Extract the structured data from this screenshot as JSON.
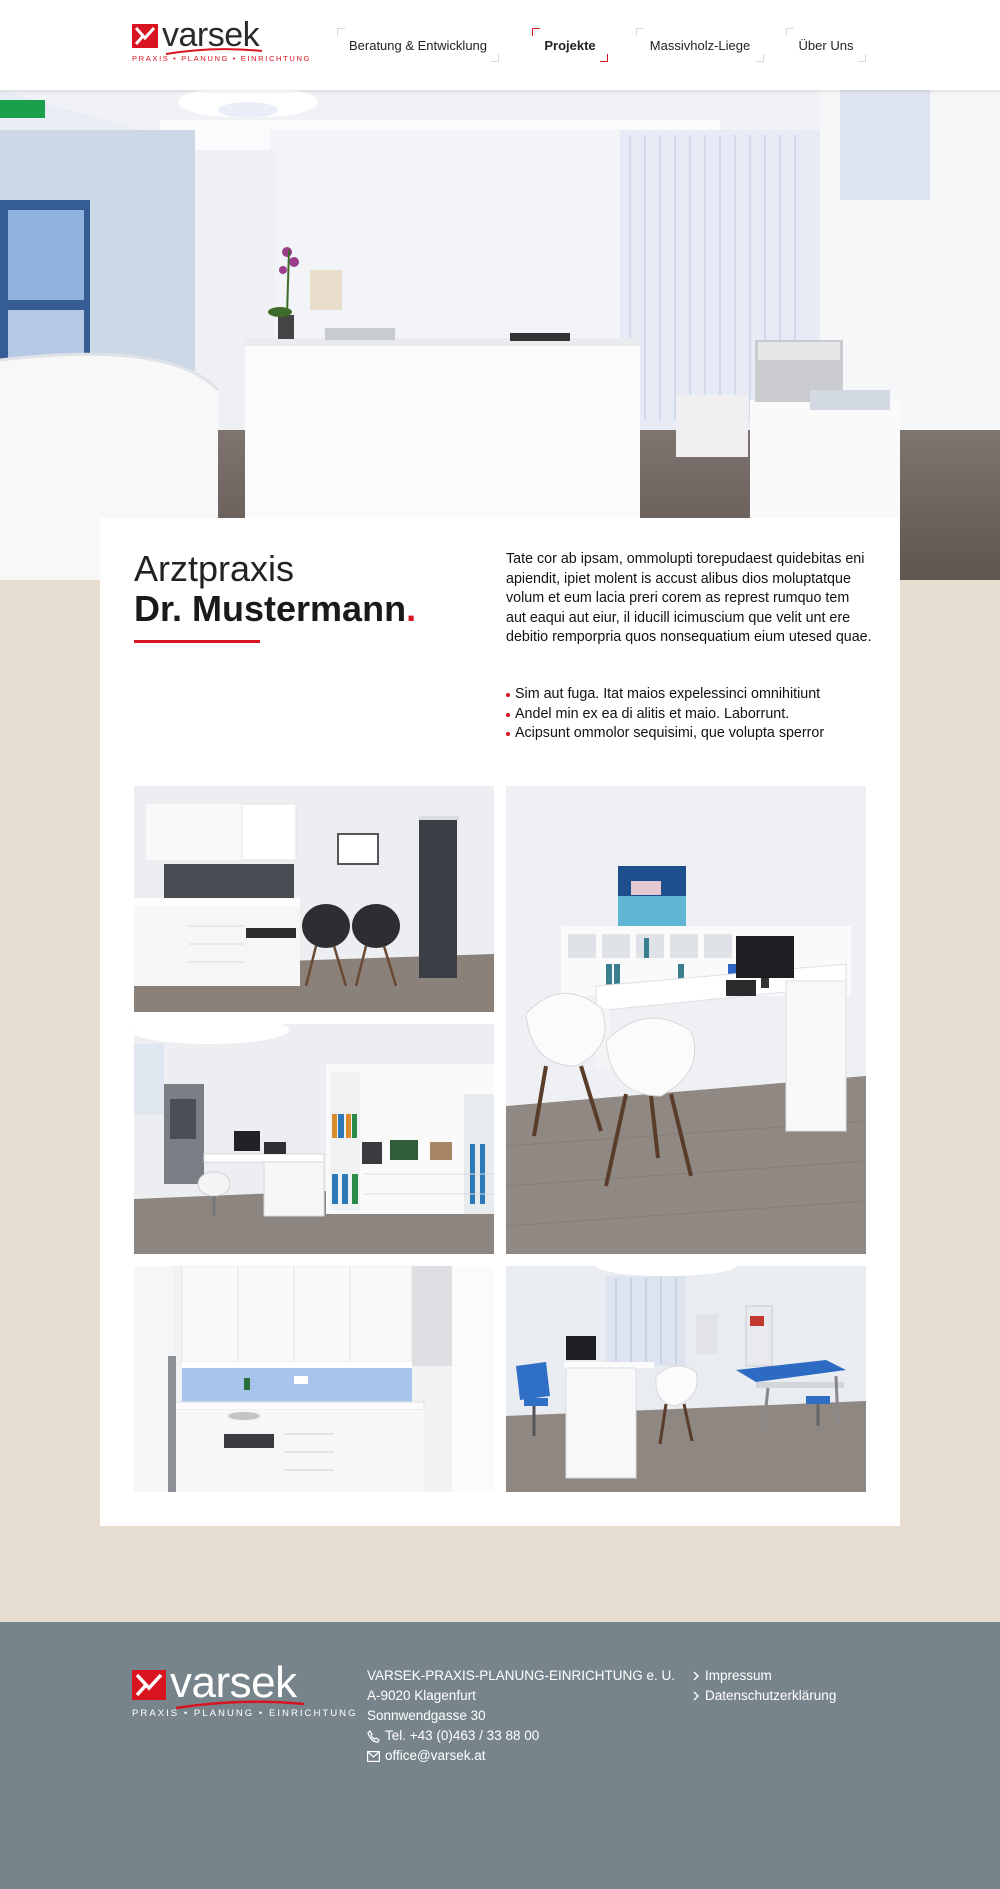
{
  "colors": {
    "accent": "#d7141f",
    "beige": "#e7ddd0",
    "footer": "#78848c"
  },
  "brand": {
    "name": "varsek",
    "tagline": "PRAXIS • PLANUNG • EINRICHTUNG"
  },
  "nav": {
    "items": [
      {
        "label": "Beratung & Entwicklung",
        "active": false
      },
      {
        "label": "Projekte",
        "active": true
      },
      {
        "label": "Massivholz-Liege",
        "active": false
      },
      {
        "label": "Über Uns",
        "active": false
      }
    ]
  },
  "project": {
    "title_light": "Arztpraxis",
    "title_bold": "Dr. Mustermann",
    "intro": "Tate cor ab ipsam, ommolupti torepudaest quidebitas eni apiendit, ipiet molent is accust alibus dios molup­tatque volum et eum lacia preri corem as represt rum­quo tem aut eaqui aut eiur, il iducill icimuscium que velit unt ere debitio remporpria quos nonsequatium eium utesed quae.",
    "bullets": [
      "Sim aut fuga. Itat maios expelessinci omnihitiunt",
      "Andel min ex ea di alitis et maio. Laborrunt.",
      "Acipsunt ommolor sequisimi, que volupta sperror"
    ]
  },
  "footer": {
    "company": "VARSEK-PRAXIS-PLANUNG-EINRICHTUNG e. U.",
    "city": "A-9020 Klagenfurt",
    "street": "Sonnwendgasse 30",
    "phone": "Tel. +43 (0)463 / 33 88 00",
    "email": "office@varsek.at",
    "links": [
      "Impressum",
      "Datenschutzerklärung"
    ]
  },
  "icons": {
    "phone": "phone-icon",
    "mail": "mail-icon",
    "chevron": "chevron-right-icon"
  }
}
